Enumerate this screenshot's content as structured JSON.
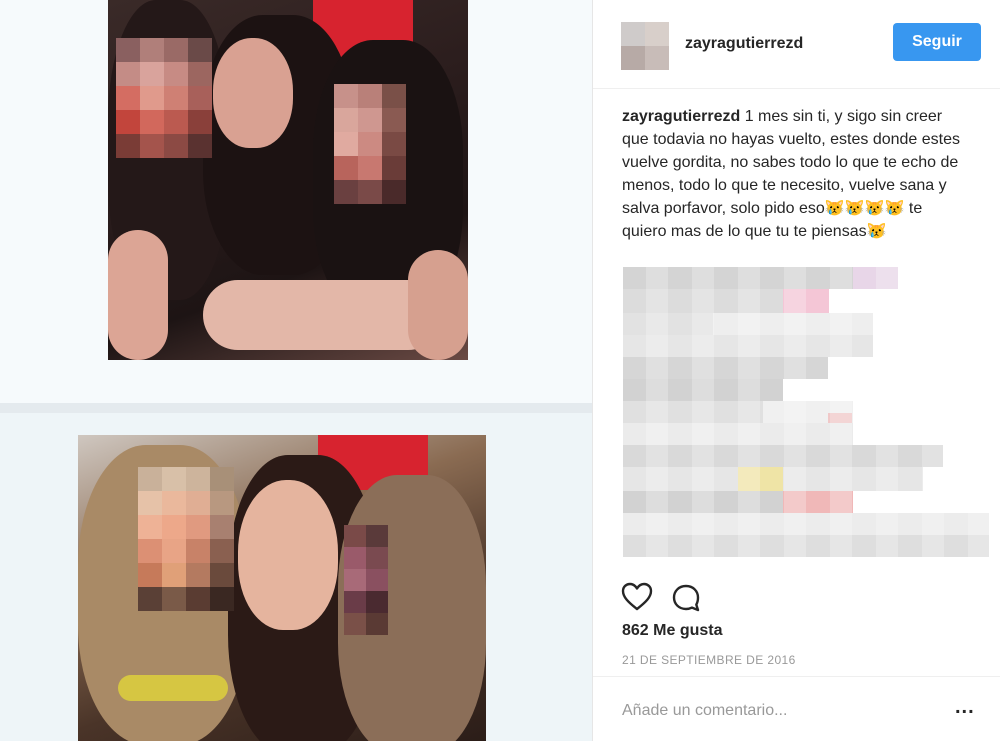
{
  "post": {
    "username": "zayragutierrezd",
    "follow_label": "Seguir",
    "caption_user": "zayragutierrezd",
    "caption_text": " 1 mes sin ti, y sigo sin creer que todavia no hayas vuelto, estes donde estes vuelve gordita, no sabes todo lo que te echo de menos, todo lo que te necesito, vuelve sana y salva porfavor, solo pido eso😿😿😿😿 te quiero mas de lo que tu te piensas😿",
    "likes": "862 Me gusta",
    "date": "21 DE SEPTIEMBRE DE 2016",
    "comment_placeholder": "Añade un comentario...",
    "more_label": "..."
  },
  "icons": {
    "like": "heart-icon",
    "comment": "comment-bubble-icon"
  },
  "colors": {
    "follow_button": "#3897f0",
    "text": "#262626",
    "muted": "#999999",
    "accent_red": "#d7232f"
  }
}
